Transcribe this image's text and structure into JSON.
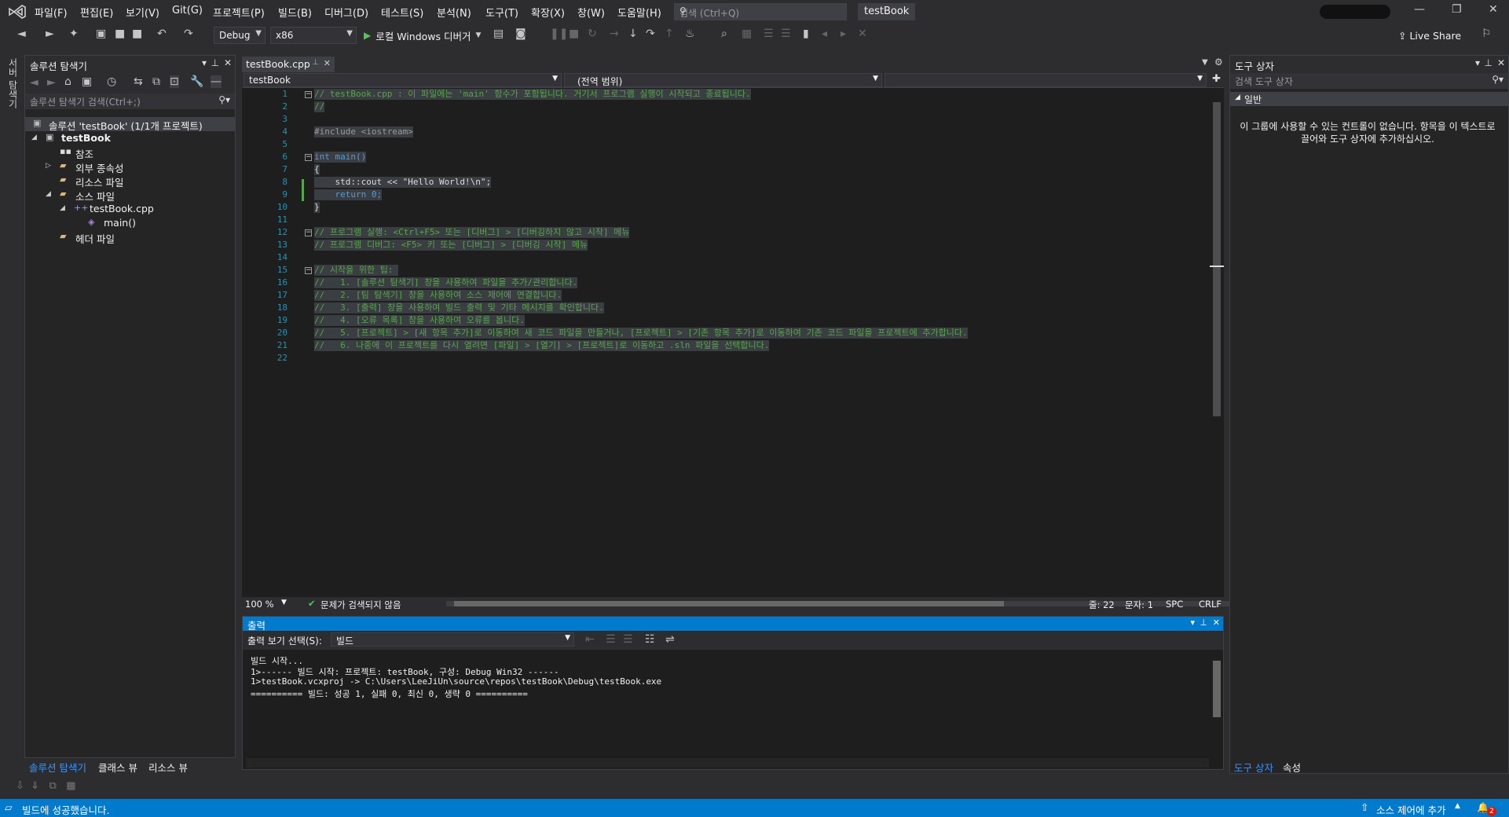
{
  "menu": [
    "파일(F)",
    "편집(E)",
    "보기(V)",
    "Git(G)",
    "프로젝트(P)",
    "빌드(B)",
    "디버그(D)",
    "테스트(S)",
    "분석(N)",
    "도구(T)",
    "확장(X)",
    "창(W)",
    "도움말(H)"
  ],
  "search": {
    "placeholder": "검색 (Ctrl+Q)"
  },
  "project_title": "testBook",
  "toolbar": {
    "config": "Debug",
    "platform": "x86",
    "run_label": "로컬 Windows 디버거",
    "live_share": "Live Share"
  },
  "left_strip_label": "서버 탐색기",
  "solution": {
    "title": "솔루션 탐색기",
    "search_placeholder": "솔루션 탐색기 검색(Ctrl+;)",
    "items": [
      {
        "label": "솔루션 'testBook' (1/1개 프로젝트)"
      },
      {
        "label": "testBook"
      },
      {
        "label": "참조"
      },
      {
        "label": "외부 종속성"
      },
      {
        "label": "리소스 파일"
      },
      {
        "label": "소스 파일"
      },
      {
        "label": "testBook.cpp"
      },
      {
        "label": "main()"
      },
      {
        "label": "헤더 파일"
      }
    ],
    "bottom_tabs": [
      "솔루션 탐색기",
      "클래스 뷰",
      "리소스 뷰"
    ]
  },
  "editor": {
    "tab": "testBook.cpp",
    "nav_project": "testBook",
    "nav_scope": "(전역 범위)",
    "line_numbers": [
      "1",
      "2",
      "3",
      "4",
      "5",
      "6",
      "7",
      "8",
      "9",
      "10",
      "11",
      "12",
      "13",
      "14",
      "15",
      "16",
      "17",
      "18",
      "19",
      "20",
      "21",
      "22"
    ],
    "lines": [
      "// testBook.cpp : 이 파일에는 'main' 함수가 포함됩니다. 거기서 프로그램 실행이 시작되고 종료됩니다.",
      "//",
      "",
      "#include <iostream>",
      "",
      "int main()",
      "{",
      "    std::cout << \"Hello World!\\n\";",
      "    return 0;",
      "}",
      "",
      "// 프로그램 실행: <Ctrl+F5> 또는 [디버그] > [디버깅하지 않고 시작] 메뉴",
      "// 프로그램 디버그: <F5> 키 또는 [디버그] > [디버깅 시작] 메뉴",
      "",
      "// 시작을 위한 팁: ",
      "//   1. [솔루션 탐색기] 창을 사용하여 파일을 추가/관리합니다.",
      "//   2. [팀 탐색기] 창을 사용하여 소스 제어에 연결합니다.",
      "//   3. [출력] 창을 사용하여 빌드 출력 및 기타 메시지를 확인합니다.",
      "//   4. [오류 목록] 창을 사용하여 오류를 봅니다.",
      "//   5. [프로젝트] > [새 항목 추가]로 이동하여 새 코드 파일을 만들거나, [프로젝트] > [기존 항목 추가]로 이동하여 기존 코드 파일을 프로젝트에 추가합니다.",
      "//   6. 나중에 이 프로젝트를 다시 열려면 [파일] > [열기] > [프로젝트]로 이동하고 .sln 파일을 선택합니다.",
      ""
    ],
    "zoom": "100 %",
    "issues": "문제가 검색되지 않음",
    "line_pos": "줄: 22",
    "col_pos": "문자: 1",
    "spc": "SPC",
    "crlf": "CRLF"
  },
  "output": {
    "title": "출력",
    "source_label": "출력 보기 선택(S):",
    "source_value": "빌드",
    "lines": [
      "빌드 시작...",
      "1>------ 빌드 시작: 프로젝트: testBook, 구성: Debug Win32 ------",
      "1>testBook.vcxproj -> C:\\Users\\LeeJiUn\\source\\repos\\testBook\\Debug\\testBook.exe",
      "========== 빌드: 성공 1, 실패 0, 최신 0, 생략 0 =========="
    ]
  },
  "toolbox": {
    "title": "도구 상자",
    "search_placeholder": "검색 도구 상자",
    "group": "일반",
    "message": "이 그룹에 사용할 수 있는 컨트롤이 없습니다. 항목을 이 텍스트로 끌어와 도구 상자에 추가하십시오.",
    "bottom_tabs": [
      "도구 상자",
      "속성"
    ]
  },
  "status": {
    "left": "빌드에 성공했습니다.",
    "source_control": "소스 제어에 추가",
    "notifications": "2"
  },
  "colors": {
    "accent": "#007acc",
    "background": "#2d2d30",
    "editor": "#1e1e1e"
  }
}
